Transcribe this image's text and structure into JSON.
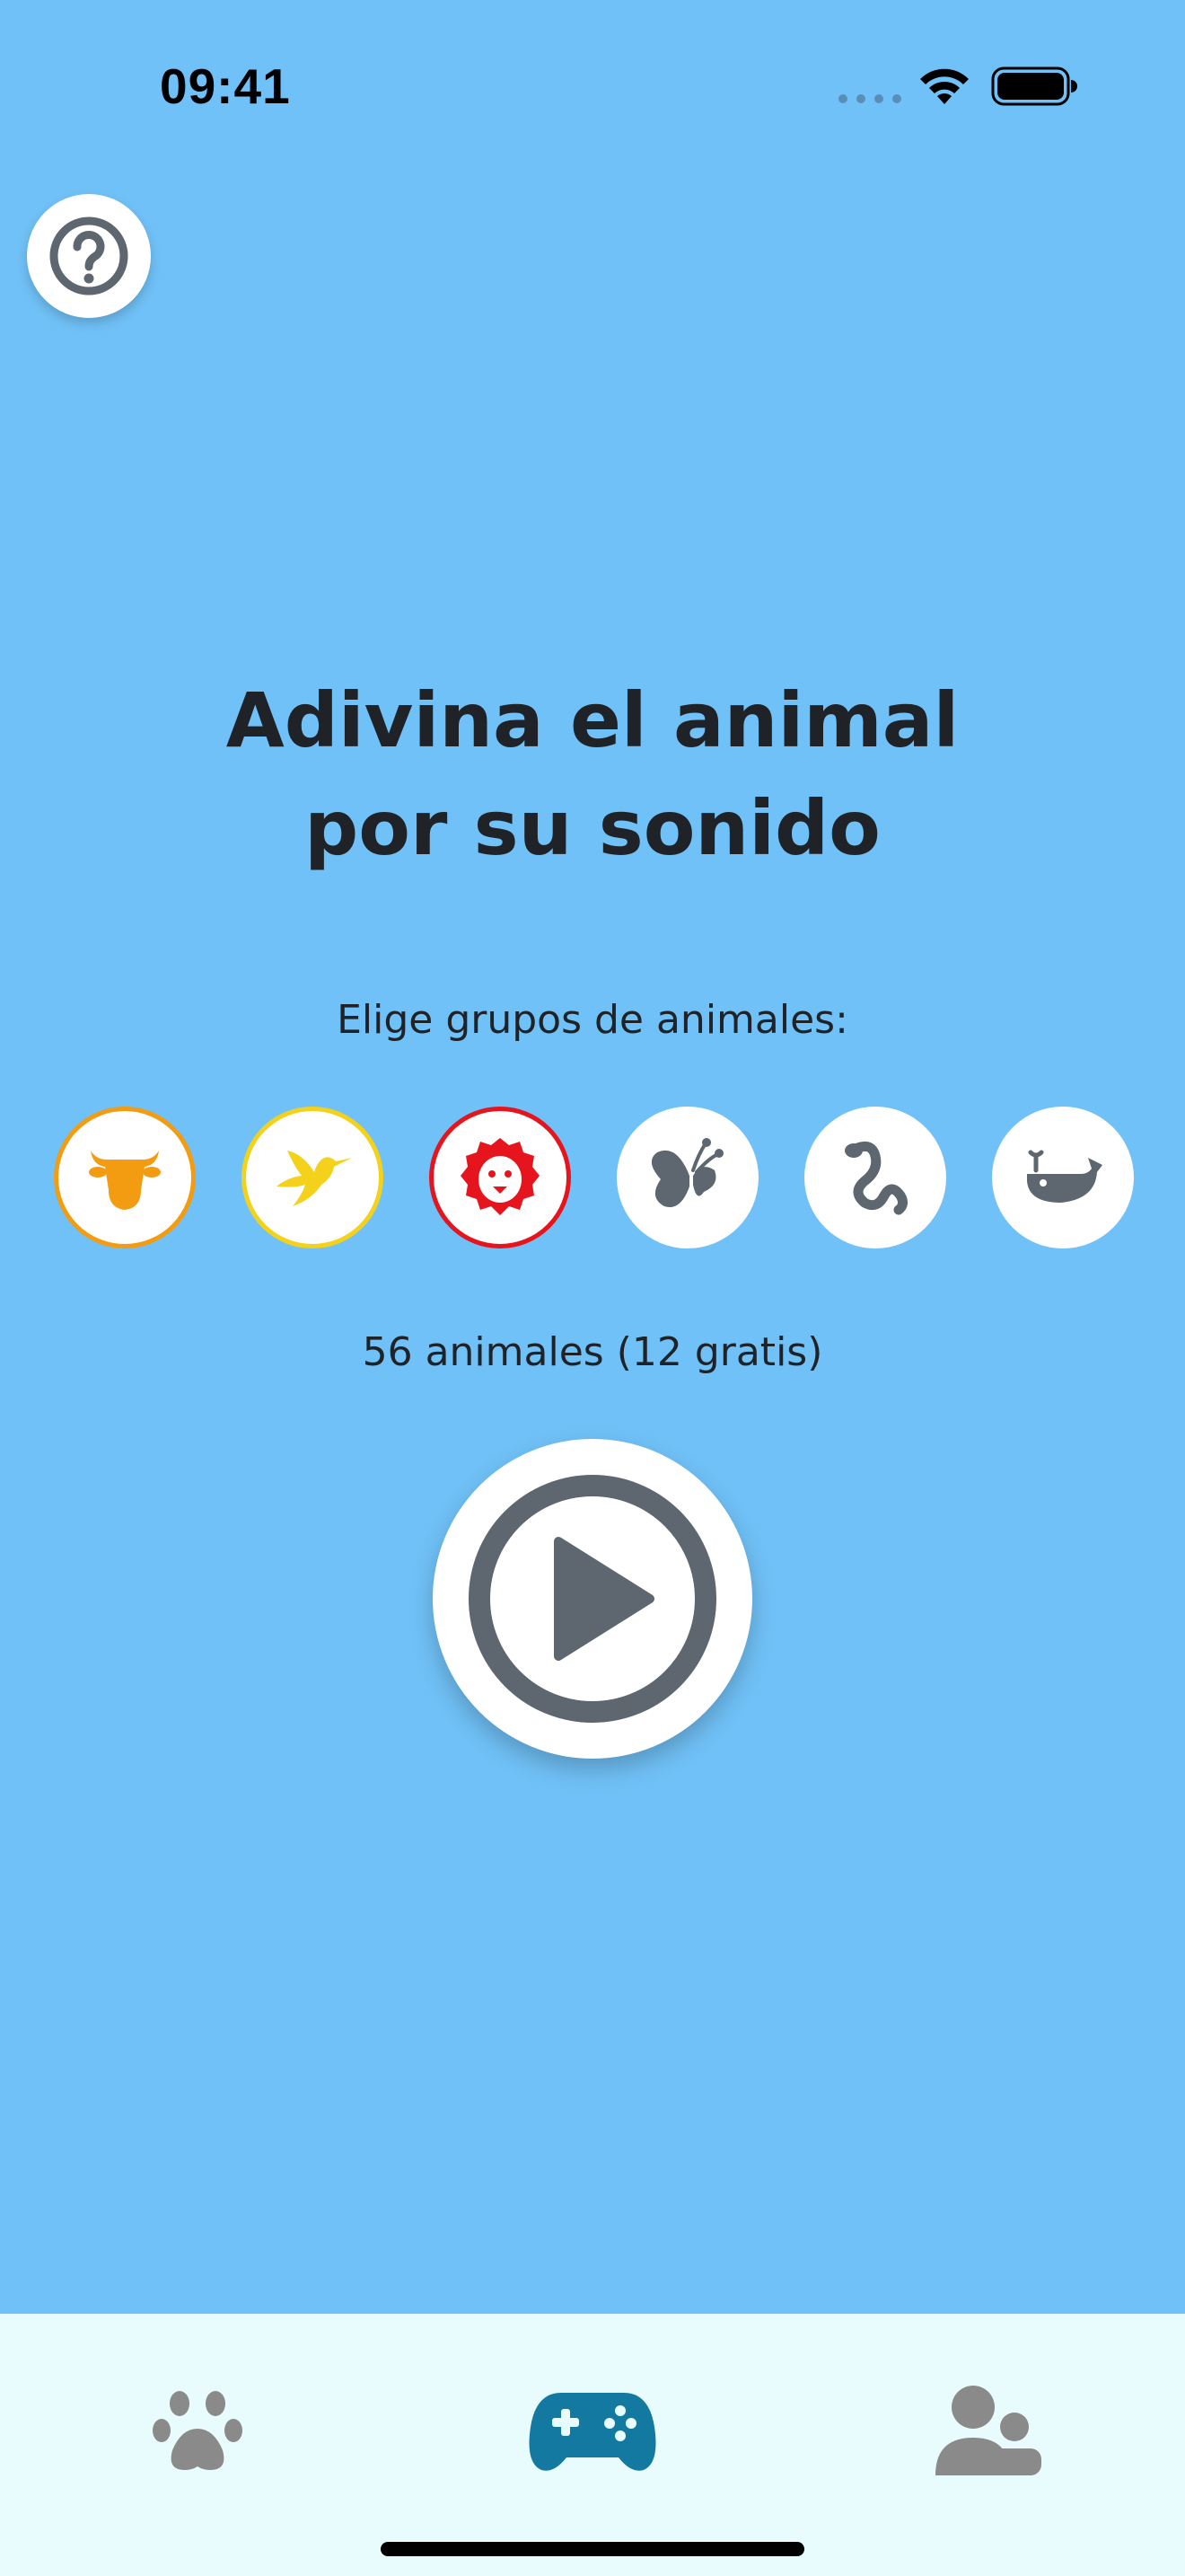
{
  "status_bar": {
    "time": "09:41"
  },
  "help_button": {
    "icon": "question-circle-icon"
  },
  "main": {
    "title_line1": "Adivina el animal",
    "title_line2": "por su sonido",
    "subtitle": "Elige grupos de animales:",
    "count_text": "56 animales (12 gratis)"
  },
  "animal_groups": [
    {
      "icon": "cow-icon",
      "selected": true,
      "color": "#F39C12"
    },
    {
      "icon": "bird-icon",
      "selected": true,
      "color": "#F4D21B"
    },
    {
      "icon": "lion-icon",
      "selected": true,
      "color": "#E5141D"
    },
    {
      "icon": "butterfly-icon",
      "selected": false,
      "color": "#5E6670"
    },
    {
      "icon": "snake-icon",
      "selected": false,
      "color": "#5E6670"
    },
    {
      "icon": "whale-icon",
      "selected": false,
      "color": "#5E6670"
    }
  ],
  "play_button": {
    "icon": "play-circle-icon"
  },
  "tab_bar": {
    "tabs": [
      {
        "icon": "paw-icon",
        "active": false
      },
      {
        "icon": "gamepad-icon",
        "active": true
      },
      {
        "icon": "users-icon",
        "active": false
      }
    ],
    "active_color": "#1479A1",
    "inactive_color": "#8A8A8A"
  },
  "colors": {
    "background": "#70C1F7",
    "text": "#1F2328",
    "tab_bar_background": "#E9FCFD"
  }
}
